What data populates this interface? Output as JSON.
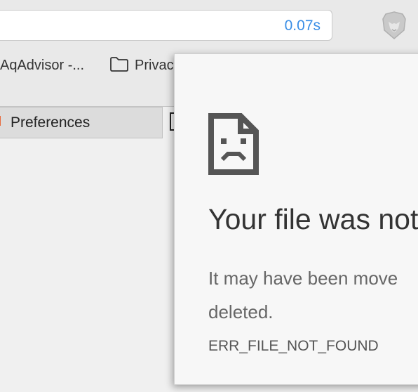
{
  "toolbar": {
    "load_time": "0.07s",
    "shield_icon": "brave-lion-icon"
  },
  "bookmarks": {
    "items": [
      {
        "label": "AqAdvisor -...",
        "icon": "none"
      },
      {
        "label": "Privac",
        "icon": "folder-icon"
      }
    ]
  },
  "tabs": [
    {
      "label": "Preferences",
      "active": true
    }
  ],
  "error_page": {
    "icon": "sad-document-icon",
    "title": "Your file was not",
    "description_line1": "It may have been move",
    "description_line2": "deleted.",
    "error_code": "ERR_FILE_NOT_FOUND"
  },
  "colors": {
    "accent": "#3a8ee6",
    "chrome_bg": "#e9e9e9",
    "page_bg": "#f7f7f7"
  }
}
